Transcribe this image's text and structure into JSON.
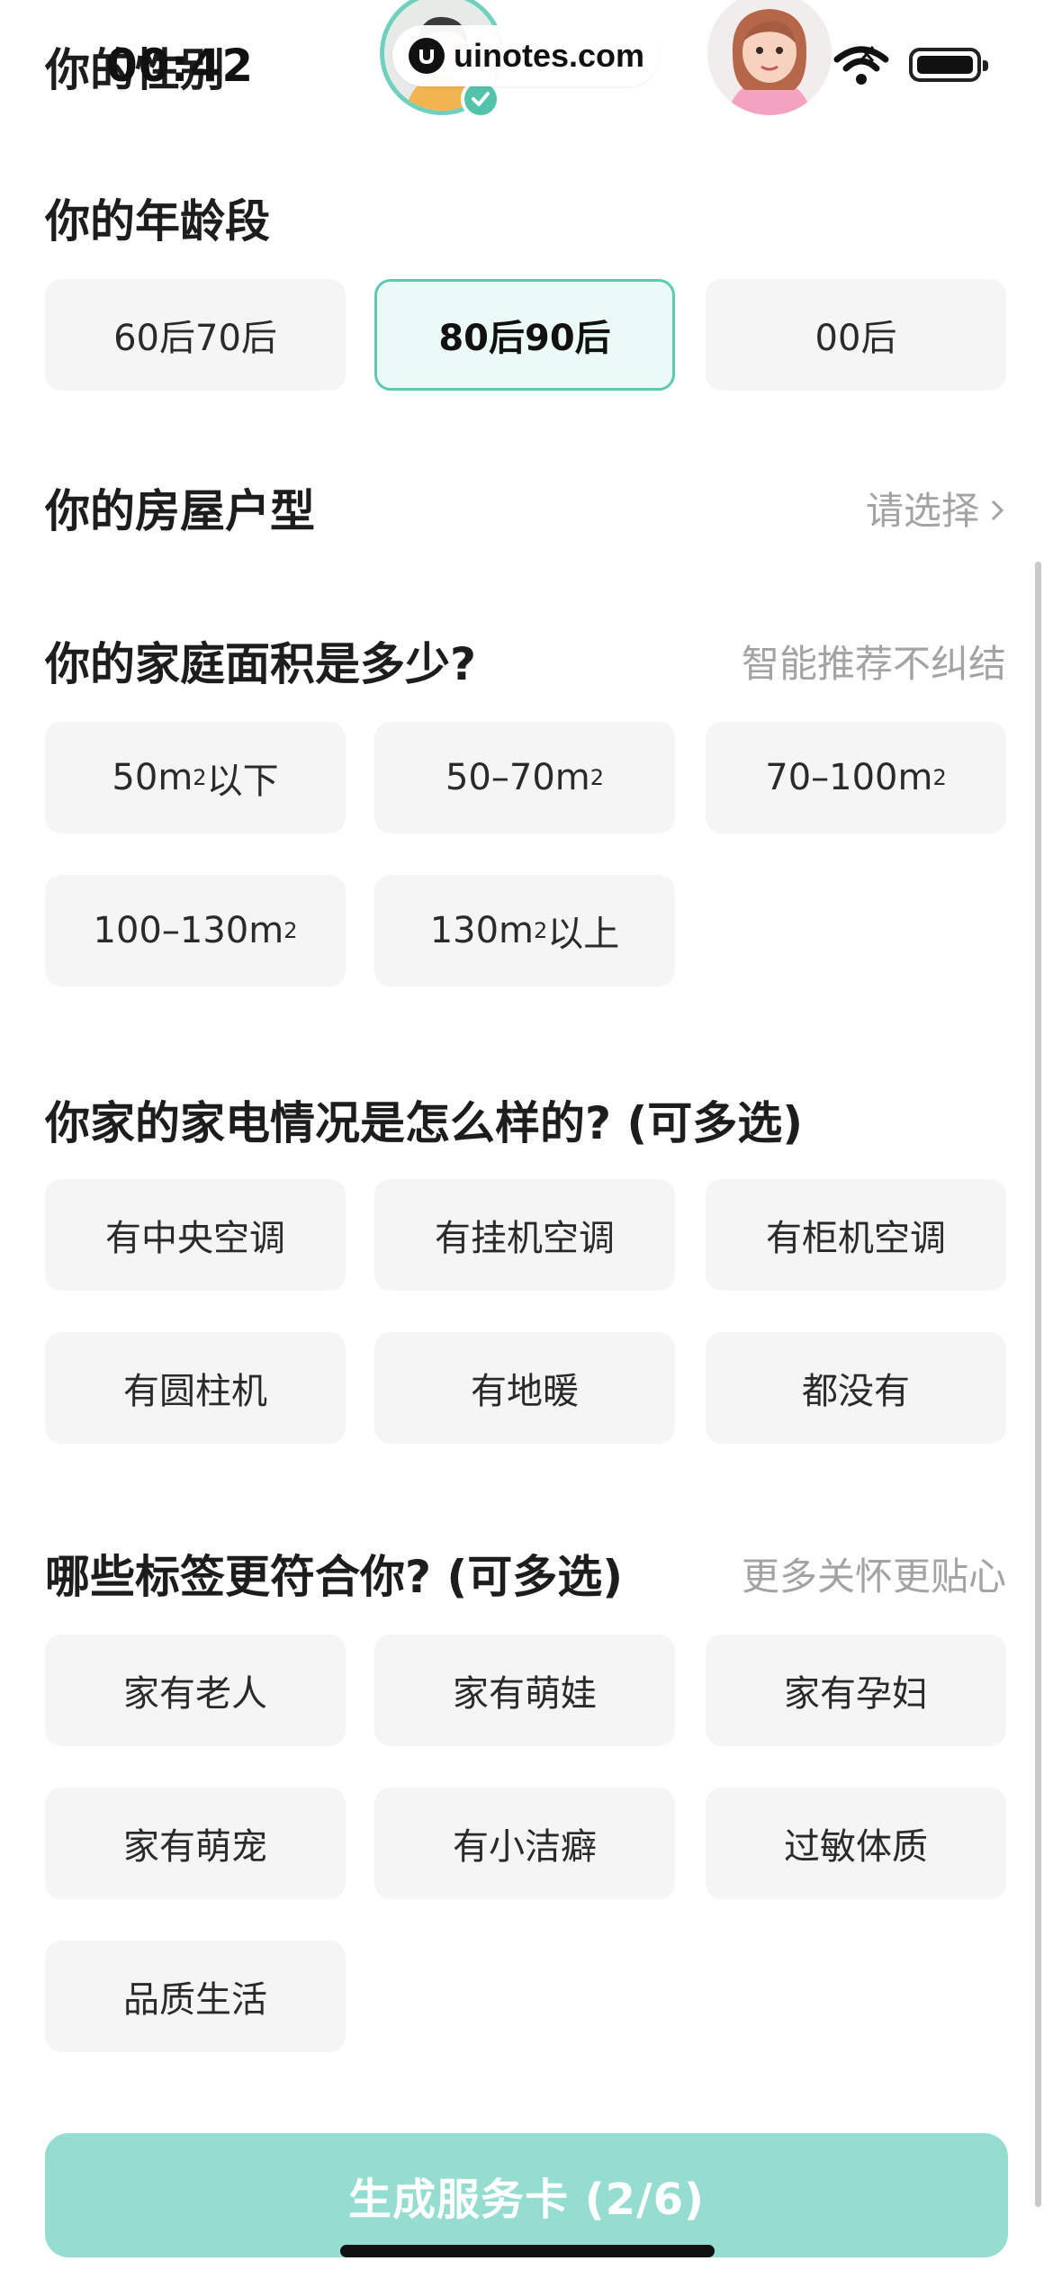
{
  "status_bar": {
    "time": "00:42"
  },
  "top": {
    "cut_heading": "你的性别",
    "watermark": "uinotes.com"
  },
  "age": {
    "title": "你的年龄段",
    "options": [
      "60后70后",
      "80后90后",
      "00后"
    ],
    "selected": "80后90后"
  },
  "house_type": {
    "title": "你的房屋户型",
    "placeholder": "请选择"
  },
  "area": {
    "title": "你的家庭面积是多少?",
    "hint": "智能推荐不纠结",
    "options": [
      {
        "text": "50m",
        "suffix": "以下"
      },
      {
        "text": "50–70m",
        "suffix": ""
      },
      {
        "text": "70–100m",
        "suffix": ""
      },
      {
        "text": "100–130m",
        "suffix": ""
      },
      {
        "text": "130m",
        "suffix": "以上"
      }
    ],
    "unit_sup": "2"
  },
  "appliances": {
    "title": "你家的家电情况是怎么样的? (可多选)",
    "options": [
      "有中央空调",
      "有挂机空调",
      "有柜机空调",
      "有圆柱机",
      "有地暖",
      "都没有"
    ]
  },
  "tags": {
    "title": "哪些标签更符合你? (可多选)",
    "hint": "更多关怀更贴心",
    "options": [
      "家有老人",
      "家有萌娃",
      "家有孕妇",
      "家有萌宠",
      "有小洁癖",
      "过敏体质",
      "品质生活"
    ]
  },
  "action": {
    "label": "生成服务卡 (2/6)"
  },
  "colors": {
    "accent": "#5ccab3",
    "button": "#95ddd0",
    "option_bg": "#f5f5f5",
    "selected_bg": "#ebfaf6"
  }
}
